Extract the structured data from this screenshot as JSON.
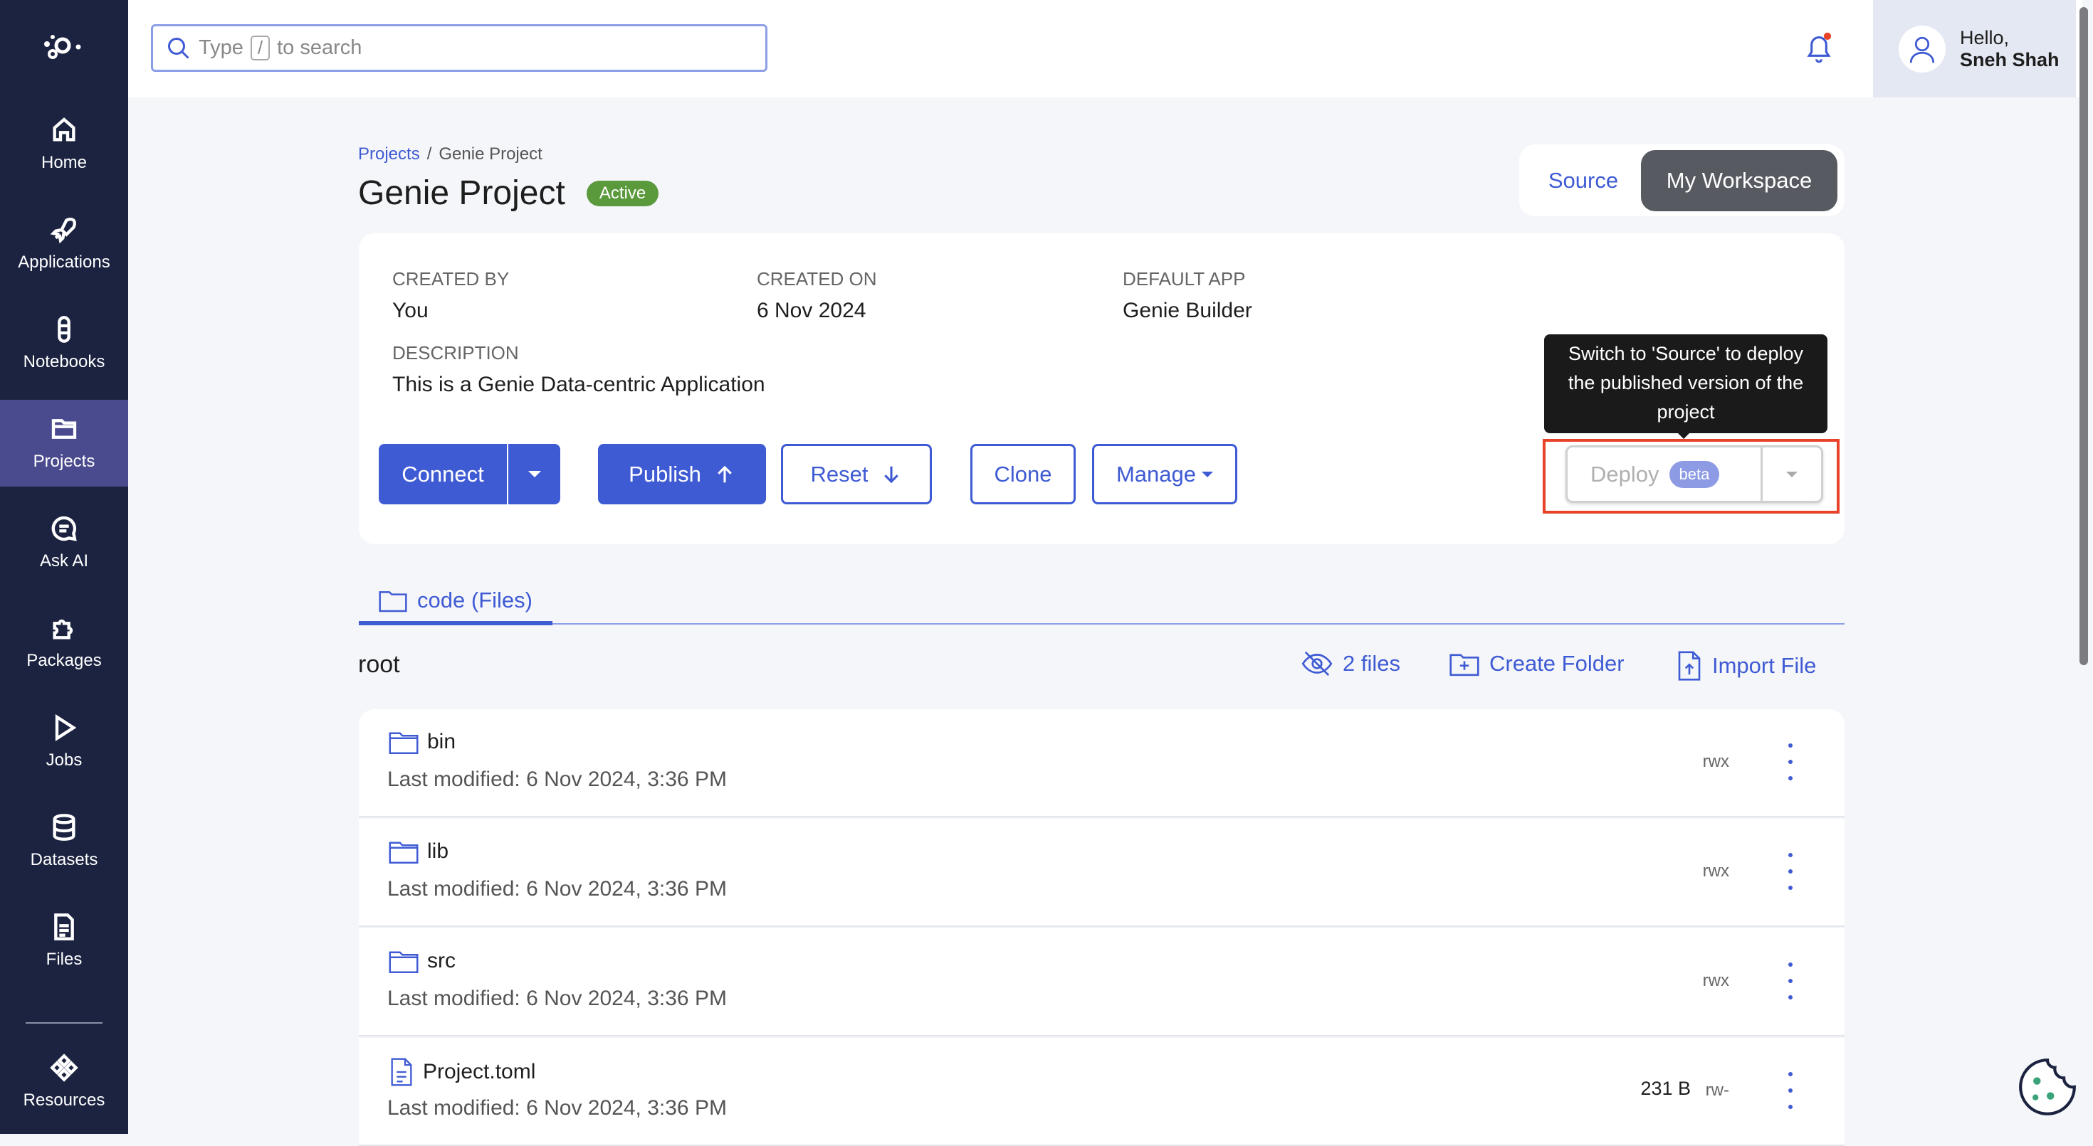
{
  "sidebar": {
    "items": [
      {
        "label": "Home",
        "icon": "home-icon"
      },
      {
        "label": "Applications",
        "icon": "rocket-icon"
      },
      {
        "label": "Notebooks",
        "icon": "notebook-icon"
      },
      {
        "label": "Projects",
        "icon": "folder-icon",
        "active": true
      },
      {
        "label": "Ask AI",
        "icon": "chat-icon"
      },
      {
        "label": "Packages",
        "icon": "puzzle-icon"
      },
      {
        "label": "Jobs",
        "icon": "play-icon"
      },
      {
        "label": "Datasets",
        "icon": "database-icon"
      },
      {
        "label": "Files",
        "icon": "file-icon"
      },
      {
        "label": "Resources",
        "icon": "resources-icon"
      }
    ]
  },
  "search": {
    "prefix": "Type",
    "key": "/",
    "suffix": "to search"
  },
  "user": {
    "greeting": "Hello,",
    "name": "Sneh Shah"
  },
  "breadcrumb": {
    "parent": "Projects",
    "separator": "/",
    "current": "Genie Project"
  },
  "title": "Genie Project",
  "status": "Active",
  "view_toggle": {
    "source": "Source",
    "workspace": "My Workspace",
    "selected": "My Workspace"
  },
  "info": {
    "created_by_label": "CREATED BY",
    "created_by": "You",
    "created_on_label": "CREATED ON",
    "created_on": "6 Nov 2024",
    "default_app_label": "DEFAULT APP",
    "default_app": "Genie Builder",
    "description_label": "DESCRIPTION",
    "description": "This is a Genie Data-centric Application"
  },
  "actions": {
    "connect": "Connect",
    "publish": "Publish",
    "reset": "Reset",
    "clone": "Clone",
    "manage": "Manage",
    "deploy": "Deploy",
    "deploy_badge": "beta"
  },
  "tooltip": "Switch to 'Source' to deploy the published version of the project",
  "tab": "code (Files)",
  "files": {
    "path": "root",
    "count": "2 files",
    "create_folder": "Create Folder",
    "import_file": "Import File",
    "rows": [
      {
        "name": "bin",
        "type": "folder",
        "modified": "Last modified: 6 Nov 2024, 3:36 PM",
        "perm": "rwx",
        "size": ""
      },
      {
        "name": "lib",
        "type": "folder",
        "modified": "Last modified: 6 Nov 2024, 3:36 PM",
        "perm": "rwx",
        "size": ""
      },
      {
        "name": "src",
        "type": "folder",
        "modified": "Last modified: 6 Nov 2024, 3:36 PM",
        "perm": "rwx",
        "size": ""
      },
      {
        "name": "Project.toml",
        "type": "file",
        "modified": "Last modified: 6 Nov 2024, 3:36 PM",
        "perm": "rw-",
        "size": "231 B"
      }
    ]
  },
  "colors": {
    "sidebar": "#1b2340",
    "accent": "#3f5bd4",
    "active": "#4a4a8e",
    "status": "#5a9a3c",
    "highlight": "#e8432a"
  }
}
